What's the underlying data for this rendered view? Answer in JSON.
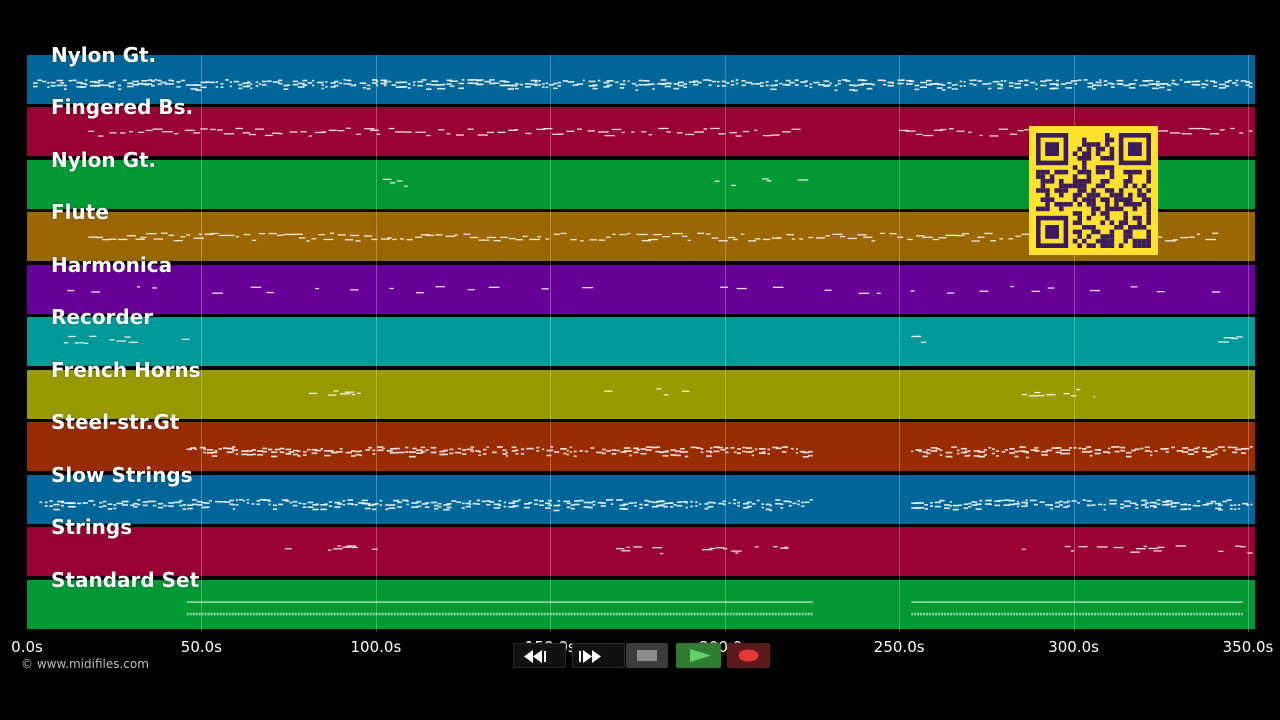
{
  "tracks": [
    {
      "label": "Nylon Gt.",
      "color": "#006699"
    },
    {
      "label": "Fingered Bs.",
      "color": "#990033"
    },
    {
      "label": "Nylon Gt.",
      "color": "#009933"
    },
    {
      "label": "Flute",
      "color": "#996600"
    },
    {
      "label": "Harmonica",
      "color": "#660099"
    },
    {
      "label": "Recorder",
      "color": "#009999"
    },
    {
      "label": "French Horns",
      "color": "#999900"
    },
    {
      "label": "Steel-str.Gt",
      "color": "#992b00"
    },
    {
      "label": "Slow Strings",
      "color": "#006699"
    },
    {
      "label": "Strings",
      "color": "#990033"
    },
    {
      "label": "Standard Set",
      "color": "#009933"
    }
  ],
  "timeline": {
    "ticks": [
      "0.0s",
      "50.0s",
      "100.0s",
      "150.0s",
      "200.0s",
      "250.0s",
      "300.0s",
      "350.0s"
    ],
    "max_seconds": 352
  },
  "copyright": "© www.midifiles.com",
  "transport": {
    "rewind_icon": "rewind-icon",
    "fast_forward_icon": "fast-forward-icon",
    "stop_icon": "stop-icon",
    "play_icon": "play-icon",
    "record_icon": "record-icon",
    "play_color": "#2e7d32",
    "record_color": "#e53935"
  },
  "qr_code": {
    "background": "#ffe22e",
    "foreground": "#3d1a5b"
  }
}
